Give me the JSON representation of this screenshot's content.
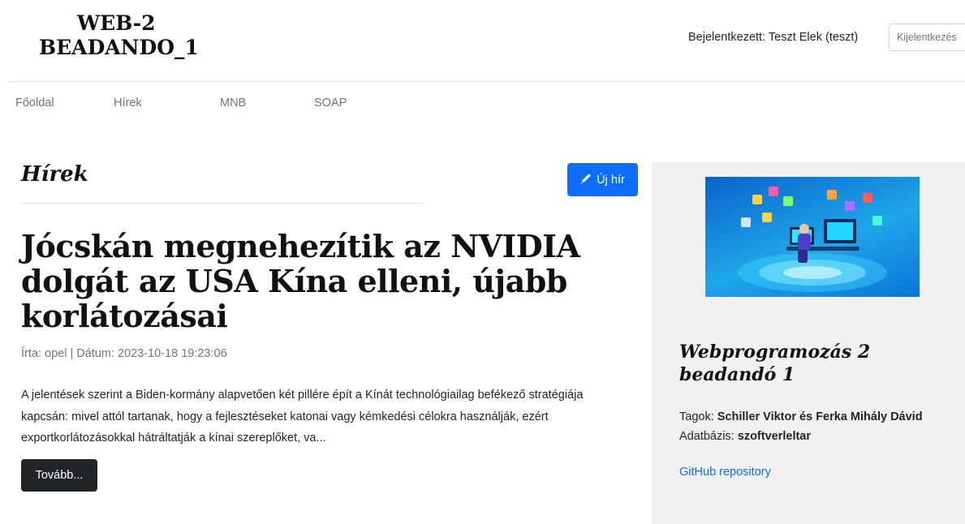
{
  "header": {
    "logo_line1": "WEB-2",
    "logo_line2": "BEADANDO_1",
    "login_status": "Bejelentkezett: Teszt Elek (teszt)",
    "logout_label": "Kijelentkezés"
  },
  "nav": {
    "items": [
      {
        "label": "Főoldal"
      },
      {
        "label": "Hírek"
      },
      {
        "label": "MNB"
      },
      {
        "label": "SOAP"
      }
    ]
  },
  "main": {
    "section_title": "Hírek",
    "new_button_label": "Új hír",
    "new_button_icon": "pencil-icon",
    "article": {
      "title": "Jócskán megnehezítik az NVIDIA dolgát az USA Kína elleni, újabb korlátozásai",
      "meta": "Írta: opel | Dátum: 2023-10-18 19:23:06",
      "excerpt": "A jelentések szerint a Biden-kormány alapvetően két pillére épít a Kínát technológiailag befékező stratégiája kapcsán: mivel attól tartanak, hogy a fejlesztéseket katonai vagy kémkedési célokra használják, ezért exportkorlátozásokkal hátráltatják a kínai szereplőket, va...",
      "more_label": "Tovább..."
    }
  },
  "sidebar": {
    "title": "Webprogramozás 2 beadandó 1",
    "members_label": "Tagok:",
    "members_value": "Schiller Viktor és Ferka Mihály Dávid",
    "db_label": "Adatbázis:",
    "db_value": "szoftverleltar",
    "github_label": "GitHub repository"
  },
  "colors": {
    "primary": "#0d6efd",
    "dark": "#212529",
    "muted": "#6c757d",
    "sidebar_bg": "#f1f1f1"
  }
}
